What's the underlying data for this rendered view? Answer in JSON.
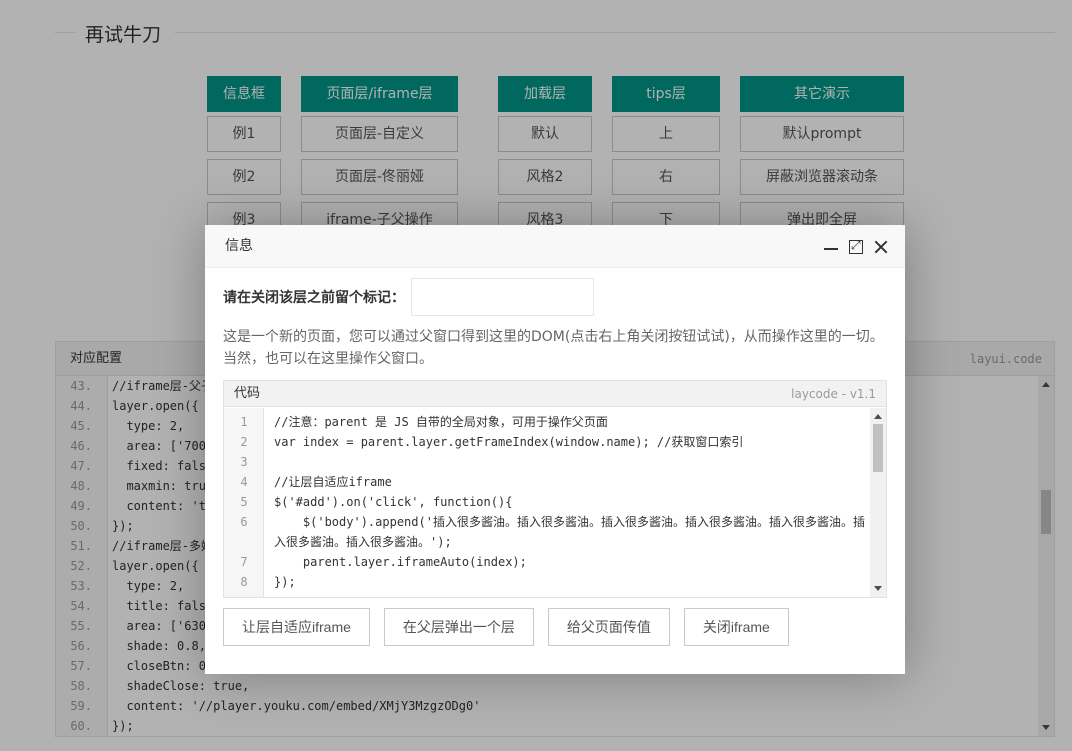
{
  "section": {
    "title": "再试牛刀"
  },
  "grid": {
    "columns": [
      {
        "head": "信息框",
        "items": [
          "例1",
          "例2",
          "例3"
        ]
      },
      {
        "head": "页面层/iframe层",
        "items": [
          "页面层-自定义",
          "页面层-佟丽娅",
          "iframe-子父操作"
        ]
      },
      {
        "head": "加载层",
        "items": [
          "默认",
          "风格2",
          "风格3"
        ]
      },
      {
        "head": "tips层",
        "items": [
          "上",
          "右",
          "下"
        ]
      },
      {
        "head": "其它演示",
        "items": [
          "默认prompt",
          "屏蔽浏览器滚动条",
          "弹出即全屏"
        ]
      }
    ]
  },
  "code_panel": {
    "title": "对应配置",
    "brand": "layui.code",
    "lines": [
      {
        "n": "43.",
        "text": "//iframe层-父子"
      },
      {
        "n": "44.",
        "text": "layer.open({"
      },
      {
        "n": "45.",
        "text": "  type: 2,"
      },
      {
        "n": "46.",
        "text": "  area: ['700"
      },
      {
        "n": "47.",
        "text": "  fixed: fals"
      },
      {
        "n": "48.",
        "text": "  maxmin: tru"
      },
      {
        "n": "49.",
        "text": "  content: 't"
      },
      {
        "n": "50.",
        "text": "});"
      },
      {
        "n": "51.",
        "text": "//iframe层-多媒"
      },
      {
        "n": "52.",
        "text": "layer.open({"
      },
      {
        "n": "53.",
        "text": "  type: 2,"
      },
      {
        "n": "54.",
        "text": "  title: fals"
      },
      {
        "n": "55.",
        "text": "  area: ['630"
      },
      {
        "n": "56.",
        "text": "  shade: 0.8,"
      },
      {
        "n": "57.",
        "text": "  closeBtn: 0"
      },
      {
        "n": "58.",
        "text": "  shadeClose: true,"
      },
      {
        "n": "59.",
        "text": "  content: '//player.youku.com/embed/XMjY3MzgzODg0'"
      },
      {
        "n": "60.",
        "text": "});"
      }
    ]
  },
  "modal": {
    "title": "信息",
    "mark_label": "请在关闭该层之前留个标记：",
    "mark_value": "",
    "description_1": "这是一个新的页面，您可以通过父窗口得到这里的DOM(点击右上角关闭按钮试试)，从而操作这里的一切。",
    "description_2": "当然，也可以在这里操作父窗口。",
    "code": {
      "title": "代码",
      "version": "laycode - v1.1",
      "lines": [
        {
          "n": "1",
          "text": "//注意：parent 是 JS 自带的全局对象，可用于操作父页面"
        },
        {
          "n": "2",
          "text": "var index = parent.layer.getFrameIndex(window.name); //获取窗口索引"
        },
        {
          "n": "3",
          "text": ""
        },
        {
          "n": "4",
          "text": "//让层自适应iframe"
        },
        {
          "n": "5",
          "text": "$('#add').on('click', function(){"
        },
        {
          "n": "6",
          "text": "    $('body').append('插入很多酱油。插入很多酱油。插入很多酱油。插入很多酱油。插入很多酱油。插入很多酱油。插入很多酱油。');"
        },
        {
          "n": "7",
          "text": "    parent.layer.iframeAuto(index);"
        },
        {
          "n": "8",
          "text": "});"
        }
      ]
    },
    "buttons": {
      "auto_fit": "让层自适应iframe",
      "popup_in_parent": "在父层弹出一个层",
      "pass_value": "给父页面传值",
      "close_iframe": "关闭iframe"
    }
  }
}
